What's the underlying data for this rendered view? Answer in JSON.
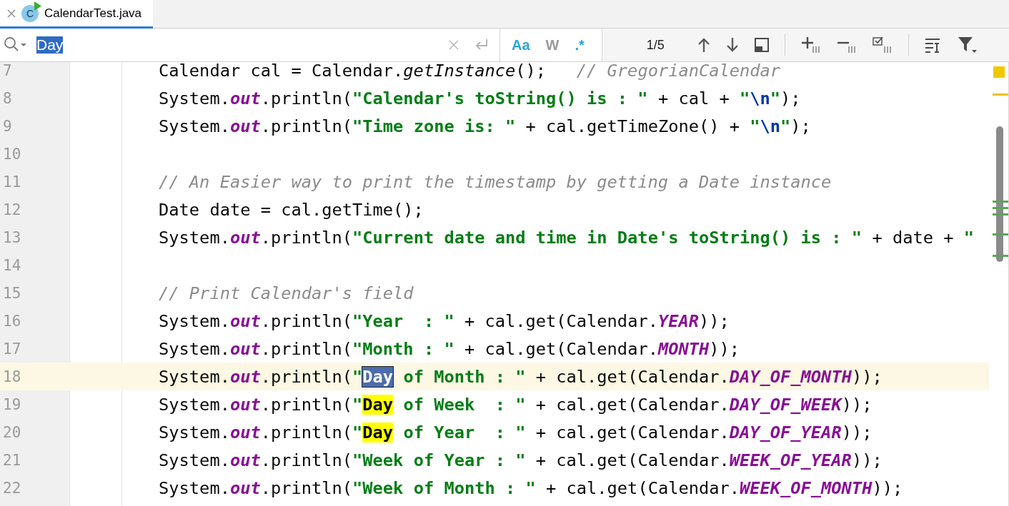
{
  "tabs": [
    {
      "label": "CalendarTest.java",
      "icon_letter": "C",
      "selected": true
    }
  ],
  "find_bar": {
    "query": "Day",
    "toggles": [
      {
        "label": "Aa",
        "selected": true
      },
      {
        "label": "W",
        "selected": false
      },
      {
        "label": ".*",
        "selected": true
      }
    ],
    "match_count": "1/5"
  },
  "editor": {
    "lines": [
      {
        "number": "7",
        "current": false,
        "tokens": [
          {
            "kind": "plain",
            "text": "Calendar cal = Calendar."
          },
          {
            "kind": "method",
            "text": "getInstance"
          },
          {
            "kind": "plain",
            "text": "();   "
          },
          {
            "kind": "comment",
            "text": "// GregorianCalendar"
          }
        ]
      },
      {
        "number": "8",
        "current": false,
        "tokens": [
          {
            "kind": "plain",
            "text": "System."
          },
          {
            "kind": "field",
            "text": "out"
          },
          {
            "kind": "plain",
            "text": ".println("
          },
          {
            "kind": "string",
            "text": "\"Calendar's toString() is : \""
          },
          {
            "kind": "plain",
            "text": " + cal + "
          },
          {
            "kind": "string",
            "text": "\""
          },
          {
            "kind": "escape",
            "text": "\\n"
          },
          {
            "kind": "string",
            "text": "\""
          },
          {
            "kind": "plain",
            "text": ");"
          }
        ]
      },
      {
        "number": "9",
        "current": false,
        "tokens": [
          {
            "kind": "plain",
            "text": "System."
          },
          {
            "kind": "field",
            "text": "out"
          },
          {
            "kind": "plain",
            "text": ".println("
          },
          {
            "kind": "string",
            "text": "\"Time zone is: \""
          },
          {
            "kind": "plain",
            "text": " + cal.getTimeZone() + "
          },
          {
            "kind": "string",
            "text": "\""
          },
          {
            "kind": "escape",
            "text": "\\n"
          },
          {
            "kind": "string",
            "text": "\""
          },
          {
            "kind": "plain",
            "text": ");"
          }
        ]
      },
      {
        "number": "10",
        "current": false
      },
      {
        "number": "11",
        "current": false,
        "tokens": [
          {
            "kind": "comment",
            "text": "// An Easier way to print the timestamp by getting a Date instance"
          }
        ]
      },
      {
        "number": "12",
        "current": false,
        "tokens": [
          {
            "kind": "plain",
            "text": "Date date = cal.getTime();"
          }
        ]
      },
      {
        "number": "13",
        "current": false,
        "tokens": [
          {
            "kind": "plain",
            "text": "System."
          },
          {
            "kind": "field",
            "text": "out"
          },
          {
            "kind": "plain",
            "text": ".println("
          },
          {
            "kind": "string",
            "text": "\"Current date and time in Date's toString() is : \""
          },
          {
            "kind": "plain",
            "text": " + date + "
          },
          {
            "kind": "string",
            "text": "\""
          }
        ]
      },
      {
        "number": "14",
        "current": false
      },
      {
        "number": "15",
        "current": false,
        "tokens": [
          {
            "kind": "comment",
            "text": "// Print Calendar's field"
          }
        ]
      },
      {
        "number": "16",
        "current": false,
        "tokens": [
          {
            "kind": "plain",
            "text": "System."
          },
          {
            "kind": "field",
            "text": "out"
          },
          {
            "kind": "plain",
            "text": ".println("
          },
          {
            "kind": "string",
            "text": "\"Year  : \""
          },
          {
            "kind": "plain",
            "text": " + cal.get(Calendar."
          },
          {
            "kind": "field",
            "text": "YEAR"
          },
          {
            "kind": "plain",
            "text": "));"
          }
        ]
      },
      {
        "number": "17",
        "current": false,
        "tokens": [
          {
            "kind": "plain",
            "text": "System."
          },
          {
            "kind": "field",
            "text": "out"
          },
          {
            "kind": "plain",
            "text": ".println("
          },
          {
            "kind": "string",
            "text": "\"Month : \""
          },
          {
            "kind": "plain",
            "text": " + cal.get(Calendar."
          },
          {
            "kind": "field",
            "text": "MONTH"
          },
          {
            "kind": "plain",
            "text": "));"
          }
        ]
      },
      {
        "number": "18",
        "current": true,
        "tokens": [
          {
            "kind": "plain",
            "text": "System."
          },
          {
            "kind": "field",
            "text": "out"
          },
          {
            "kind": "plain",
            "text": ".println("
          },
          {
            "kind": "string",
            "text": "\""
          },
          {
            "kind": "current-match",
            "text": "Day"
          },
          {
            "kind": "string",
            "text": " of Month : \""
          },
          {
            "kind": "plain",
            "text": " + cal.get(Calendar."
          },
          {
            "kind": "field",
            "text": "DAY_OF_MONTH"
          },
          {
            "kind": "plain",
            "text": "));"
          }
        ]
      },
      {
        "number": "19",
        "current": false,
        "tokens": [
          {
            "kind": "plain",
            "text": "System."
          },
          {
            "kind": "field",
            "text": "out"
          },
          {
            "kind": "plain",
            "text": ".println("
          },
          {
            "kind": "string",
            "text": "\""
          },
          {
            "kind": "match",
            "text": "Day"
          },
          {
            "kind": "string",
            "text": " of Week  : \""
          },
          {
            "kind": "plain",
            "text": " + cal.get(Calendar."
          },
          {
            "kind": "field",
            "text": "DAY_OF_WEEK"
          },
          {
            "kind": "plain",
            "text": "));"
          }
        ]
      },
      {
        "number": "20",
        "current": false,
        "tokens": [
          {
            "kind": "plain",
            "text": "System."
          },
          {
            "kind": "field",
            "text": "out"
          },
          {
            "kind": "plain",
            "text": ".println("
          },
          {
            "kind": "string",
            "text": "\""
          },
          {
            "kind": "match",
            "text": "Day"
          },
          {
            "kind": "string",
            "text": " of Year  : \""
          },
          {
            "kind": "plain",
            "text": " + cal.get(Calendar."
          },
          {
            "kind": "field",
            "text": "DAY_OF_YEAR"
          },
          {
            "kind": "plain",
            "text": "));"
          }
        ]
      },
      {
        "number": "21",
        "current": false,
        "tokens": [
          {
            "kind": "plain",
            "text": "System."
          },
          {
            "kind": "field",
            "text": "out"
          },
          {
            "kind": "plain",
            "text": ".println("
          },
          {
            "kind": "string",
            "text": "\"Week of Year : \""
          },
          {
            "kind": "plain",
            "text": " + cal.get(Calendar."
          },
          {
            "kind": "field",
            "text": "WEEK_OF_YEAR"
          },
          {
            "kind": "plain",
            "text": "));"
          }
        ]
      },
      {
        "number": "22",
        "current": false,
        "tokens": [
          {
            "kind": "plain",
            "text": "System."
          },
          {
            "kind": "field",
            "text": "out"
          },
          {
            "kind": "plain",
            "text": ".println("
          },
          {
            "kind": "string",
            "text": "\"Week of Month : \""
          },
          {
            "kind": "plain",
            "text": " + cal.get(Calendar."
          },
          {
            "kind": "field",
            "text": "WEEK_OF_MONTH"
          },
          {
            "kind": "plain",
            "text": "));"
          }
        ]
      }
    ]
  }
}
